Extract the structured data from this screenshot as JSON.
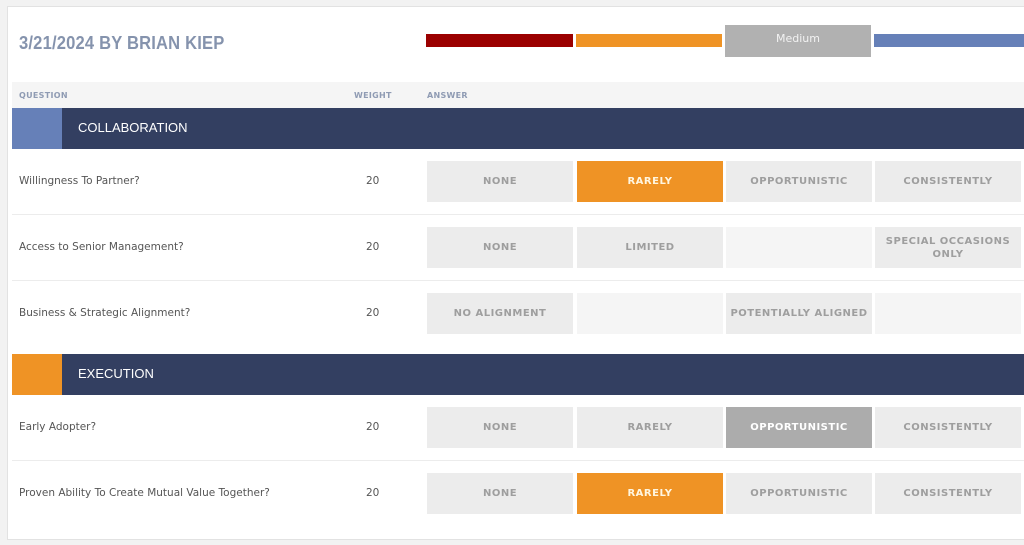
{
  "header": {
    "title": "3/21/2024 BY BRIAN KIEP"
  },
  "legend": {
    "segments": [
      {
        "name": "low",
        "color": "#9b0000",
        "label": ""
      },
      {
        "name": "medium-low",
        "color": "#ef9325",
        "label": ""
      },
      {
        "name": "medium",
        "color": "#b1b1b1",
        "label": "Medium"
      },
      {
        "name": "high",
        "color": "#6680b8",
        "label": ""
      }
    ]
  },
  "columns": {
    "question": "QUESTION",
    "weight": "WEIGHT",
    "answer": "ANSWER"
  },
  "sections": [
    {
      "title": "COLLABORATION",
      "accent": "#6680b8",
      "questions": [
        {
          "text": "Willingness To Partner?",
          "weight": "20",
          "answers": [
            {
              "label": "NONE",
              "state": "option"
            },
            {
              "label": "RARELY",
              "state": "selected-orange"
            },
            {
              "label": "OPPORTUNISTIC",
              "state": "option"
            },
            {
              "label": "CONSISTENTLY",
              "state": "option"
            }
          ]
        },
        {
          "text": "Access to Senior Management?",
          "weight": "20",
          "answers": [
            {
              "label": "NONE",
              "state": "option"
            },
            {
              "label": "LIMITED",
              "state": "option"
            },
            {
              "label": "",
              "state": "empty"
            },
            {
              "label": "SPECIAL OCCASIONS ONLY",
              "state": "option"
            }
          ]
        },
        {
          "text": "Business & Strategic Alignment?",
          "weight": "20",
          "answers": [
            {
              "label": "NO ALIGNMENT",
              "state": "option"
            },
            {
              "label": "",
              "state": "empty"
            },
            {
              "label": "POTENTIALLY ALIGNED",
              "state": "option"
            },
            {
              "label": "",
              "state": "empty"
            }
          ]
        }
      ]
    },
    {
      "title": "EXECUTION",
      "accent": "#ef9325",
      "questions": [
        {
          "text": "Early Adopter?",
          "weight": "20",
          "answers": [
            {
              "label": "NONE",
              "state": "option"
            },
            {
              "label": "RARELY",
              "state": "option"
            },
            {
              "label": "OPPORTUNISTIC",
              "state": "selected-grey"
            },
            {
              "label": "CONSISTENTLY",
              "state": "option"
            }
          ]
        },
        {
          "text": "Proven Ability To Create Mutual Value Together?",
          "weight": "20",
          "answers": [
            {
              "label": "NONE",
              "state": "option"
            },
            {
              "label": "RARELY",
              "state": "selected-orange"
            },
            {
              "label": "OPPORTUNISTIC",
              "state": "option"
            },
            {
              "label": "CONSISTENTLY",
              "state": "option"
            }
          ]
        }
      ]
    }
  ]
}
